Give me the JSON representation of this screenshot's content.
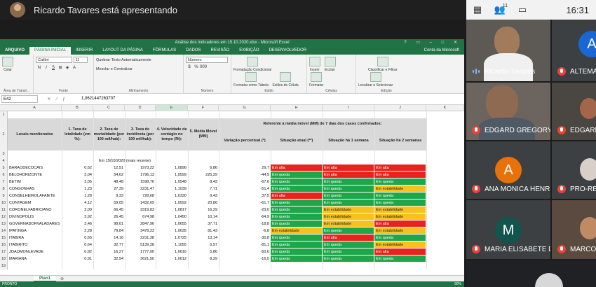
{
  "meet": {
    "presenting_text": "Ricardo Tavares está apresentando",
    "clock": "16:31",
    "participants_count": "11",
    "tiles": [
      {
        "name": "Ricardo Tavares",
        "muted": false
      },
      {
        "name": "ALTEMA",
        "letter": "A",
        "muted": true
      },
      {
        "name": "EDGARD GREGORY T...",
        "muted": true
      },
      {
        "name": "EDGARD",
        "muted": true
      },
      {
        "name": "ANA MONICA HENRI...",
        "letter": "A",
        "muted": true
      },
      {
        "name": "PRO-REIT",
        "muted": true
      },
      {
        "name": "MARIA ELISABETE D...",
        "letter": "M",
        "muted": true
      },
      {
        "name": "MARCOS",
        "muted": true
      }
    ],
    "colors": {
      "muted_red": "#ea4335",
      "tile_bg": "#3c4043",
      "orange_avatar": "#e8710a",
      "teal_avatar": "#12544e",
      "blue_avatar": "#1967d2"
    }
  },
  "excel": {
    "window_title": "Análise dos indicadores em 15.10.2020.xlsx - Microsoft Excel",
    "tabs": [
      "ARQUIVO",
      "PÁGINA INICIAL",
      "INSERIR",
      "LAYOUT DA PÁGINA",
      "FÓRMULAS",
      "DADOS",
      "REVISÃO",
      "EXIBIÇÃO",
      "DESENVOLVEDOR"
    ],
    "account": "Conta da Microsoft",
    "ribbon": {
      "paste": "Colar",
      "clipboard_group": "Área de Transf...",
      "font_name": "Calibri",
      "font_size": "11",
      "font_group": "Fonte",
      "wrap_text": "Quebrar Texto Automaticamente",
      "merge_center": "Mesclar e Centralizar",
      "alignment_group": "Alinhamento",
      "number_format": "Número",
      "number_group": "Número",
      "conditional_format": "Formatação Condicional",
      "format_table": "Formatar como Tabela",
      "cell_styles": "Estilos de Célula",
      "styles_group": "Estilo",
      "insert": "Inserir",
      "delete": "Excluir",
      "format": "Formatar",
      "cells_group": "Células",
      "sort_filter": "Classificar e Filtrar",
      "find_select": "Localizar e Selecionar",
      "editing_group": "Edição"
    },
    "name_box": "E42",
    "formula_value": "1,0621447263707",
    "columns": [
      "A",
      "B",
      "C",
      "D",
      "E",
      "F",
      "G",
      "H",
      "I",
      "J",
      "K"
    ],
    "header": {
      "col_a": "Locais monitorados",
      "col_b": "1. Taxa de letalidade (em %):",
      "col_c": "2. Taxa de mortalidade (por 100 mil/hab):",
      "col_d": "3. Taxa de incidência (por 100 mil/hab):",
      "col_e": "4. Velocidade de contágio no tempo (Rt):",
      "col_f": "5. Média Móvel (MM)",
      "mm_group": "Referente à média móvel (MM) de 7 dias dos casos confirmados:",
      "col_g": "Variação percentual (*)",
      "col_h": "Situação atual (**)",
      "col_i": "Situação há 1 semana",
      "col_j": "Situação há 2 semanas"
    },
    "date_label": "Em 15/10/2020 (mais recente)",
    "rows": [
      {
        "city": "BARAODECOCAIS",
        "b": "0,62",
        "c": "12,51",
        "d": "1973,22",
        "e": "1,0896",
        "f": "6,86",
        "g": "29,7",
        "h": "Em alta",
        "i": "Em alta",
        "j": "Em alta"
      },
      {
        "city": "BELOHORIZONTE",
        "b": "3,04",
        "c": "54,62",
        "d": "1796,13",
        "e": "1,0599",
        "f": "225,29",
        "g": "-44,9",
        "h": "Em queda",
        "i": "Em alta",
        "j": "Em alta"
      },
      {
        "city": "BETIM",
        "b": "3,05",
        "c": "48,48",
        "d": "1598,76",
        "e": "1,0548",
        "f": "8,43",
        "g": "-67,6",
        "h": "Em queda",
        "i": "Em queda",
        "j": "Em queda"
      },
      {
        "city": "CONGONHAS",
        "b": "1,23",
        "c": "27,39",
        "d": "2231,47",
        "e": "1,1039",
        "f": "7,71",
        "g": "-51,4",
        "h": "Em queda",
        "i": "Em queda",
        "j": "Em estabilidade"
      },
      {
        "city": "CONSELHEIROLAFAIETE",
        "b": "1,28",
        "c": "9,33",
        "d": "728,68",
        "e": "1,0330",
        "f": "9,43",
        "g": "37,5",
        "h": "Em alta",
        "i": "Em queda",
        "j": "Em queda"
      },
      {
        "city": "CONTAGEM",
        "b": "4,12",
        "c": "59,05",
        "d": "1432,09",
        "e": "1,0592",
        "f": "20,86",
        "g": "-61,7",
        "h": "Em queda",
        "i": "Em queda",
        "j": "Em queda"
      },
      {
        "city": "CORONELFABRICIANO",
        "b": "2,00",
        "c": "66,45",
        "d": "3319,83",
        "e": "1,0817",
        "f": "16,29",
        "g": "-23,0",
        "h": "Em queda",
        "i": "Em estabilidade",
        "j": "Em estabilidade"
      },
      {
        "city": "DIVINOPOLIS",
        "b": "3,92",
        "c": "26,45",
        "d": "674,98",
        "e": "1,0450",
        "f": "10,14",
        "g": "-64,9",
        "h": "Em queda",
        "i": "Em estabilidade",
        "j": "Em estabilidade"
      },
      {
        "city": "GOVERNADORVALADARES",
        "b": "3,46",
        "c": "98,61",
        "d": "2847,96",
        "e": "1,0655",
        "f": "37,71",
        "g": "-18,8",
        "h": "Em queda",
        "i": "Em estabilidade",
        "j": "Em alta"
      },
      {
        "city": "IPATINGA",
        "b": "2,28",
        "c": "79,84",
        "d": "3478,23",
        "e": "1,0635",
        "f": "81,43",
        "g": "-6,8",
        "h": "Em estabilidade",
        "i": "Em queda",
        "j": "Em estabilidade"
      },
      {
        "city": "ITABIRA",
        "b": "0,65",
        "c": "14,16",
        "d": "2231,38",
        "e": "1,0725",
        "f": "13,14",
        "g": "-30,8",
        "h": "Em queda",
        "i": "Em alta",
        "j": "Em queda"
      },
      {
        "city": "ITABIRITO",
        "b": "0,64",
        "c": "32,77",
        "d": "5139,28",
        "e": "1,1055",
        "f": "6,57",
        "g": "-81,1",
        "h": "Em queda",
        "i": "Em queda",
        "j": "Em estabilidade"
      },
      {
        "city": "JOAOMONLEVADE",
        "b": "0,92",
        "c": "16,27",
        "d": "1777,00",
        "e": "1,0616",
        "f": "5,86",
        "g": "-50,6",
        "h": "Em queda",
        "i": "Em queda",
        "j": "Em alta"
      },
      {
        "city": "MARIANA",
        "b": "0,91",
        "c": "32,94",
        "d": "3621,50",
        "e": "1,0612",
        "f": "8,29",
        "g": "-16,5",
        "h": "Em queda",
        "i": "Em queda",
        "j": "Em queda"
      }
    ],
    "row_numbers": [
      "1",
      "2",
      "3",
      "4",
      "5",
      "6",
      "7",
      "8",
      "9",
      "10",
      "11",
      "12",
      "13",
      "14",
      "15",
      "16",
      "17",
      "18",
      "19"
    ],
    "sheet_tab": "Plan1",
    "status": "PRONTO",
    "zoom": "90%",
    "status_colors": {
      "Em alta": "#e8231f",
      "Em queda": "#1fa64b",
      "Em estabilidade": "#f7c21d"
    }
  }
}
